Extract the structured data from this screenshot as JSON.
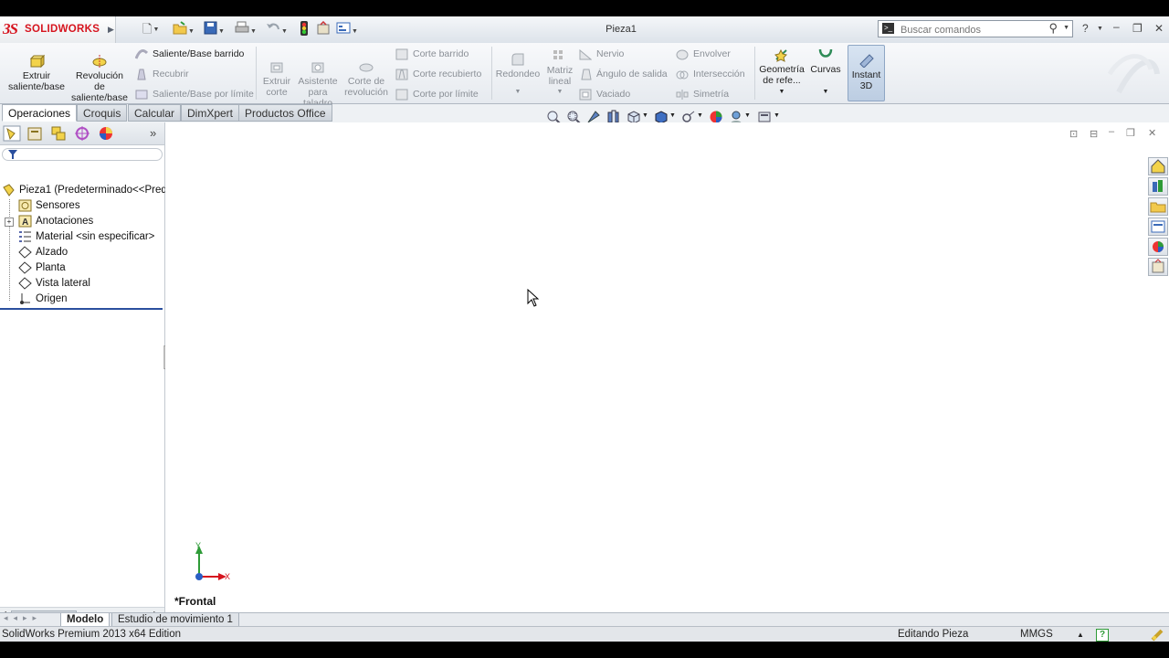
{
  "app": {
    "brand_mark": "3S",
    "brand_name": "SOLIDWORKS",
    "document_title": "Pieza1"
  },
  "search": {
    "placeholder": "Buscar comandos"
  },
  "ribbon": {
    "extrude_boss": "Extruir saliente/base",
    "revolve_boss": "Revolución de saliente/base",
    "swept_boss": "Saliente/Base barrido",
    "loft": "Recubrir",
    "boundary_boss": "Saliente/Base por límite",
    "extrude_cut": "Extruir corte",
    "hole_wizard": "Asistente para taladro",
    "revolve_cut": "Corte de revolución",
    "swept_cut": "Corte barrido",
    "lofted_cut": "Corte recubierto",
    "boundary_cut": "Corte por límite",
    "fillet": "Redondeo",
    "linear_pattern": "Matriz lineal",
    "rib": "Nervio",
    "draft": "Ángulo de salida",
    "shell": "Vaciado",
    "wrap": "Envolver",
    "intersect": "Intersección",
    "mirror": "Simetría",
    "ref_geometry": "Geometría de refe...",
    "curves": "Curvas",
    "instant3d": "Instant 3D"
  },
  "cmd_tabs": [
    "Operaciones",
    "Croquis",
    "Calcular",
    "DimXpert",
    "Productos Office"
  ],
  "tree": {
    "root": "Pieza1  (Predeterminado<<Pred",
    "items": [
      "Sensores",
      "Anotaciones",
      "Material <sin especificar>",
      "Alzado",
      "Planta",
      "Vista lateral",
      "Origen"
    ]
  },
  "fm_more": "»",
  "view": {
    "name": "*Frontal",
    "axis_x": "X",
    "axis_y": "Y"
  },
  "bottom_tabs": [
    "Modelo",
    "Estudio de movimiento 1"
  ],
  "status": {
    "edition": "SolidWorks Premium 2013 x64 Edition",
    "mode": "Editando Pieza",
    "units": "MMGS",
    "units_arrow": "▲",
    "help": "?"
  },
  "colors": {
    "brand_red": "#d6141e",
    "tree_selection_line": "#2b4f9e",
    "instant3d_bg": "#c6d6ea"
  }
}
